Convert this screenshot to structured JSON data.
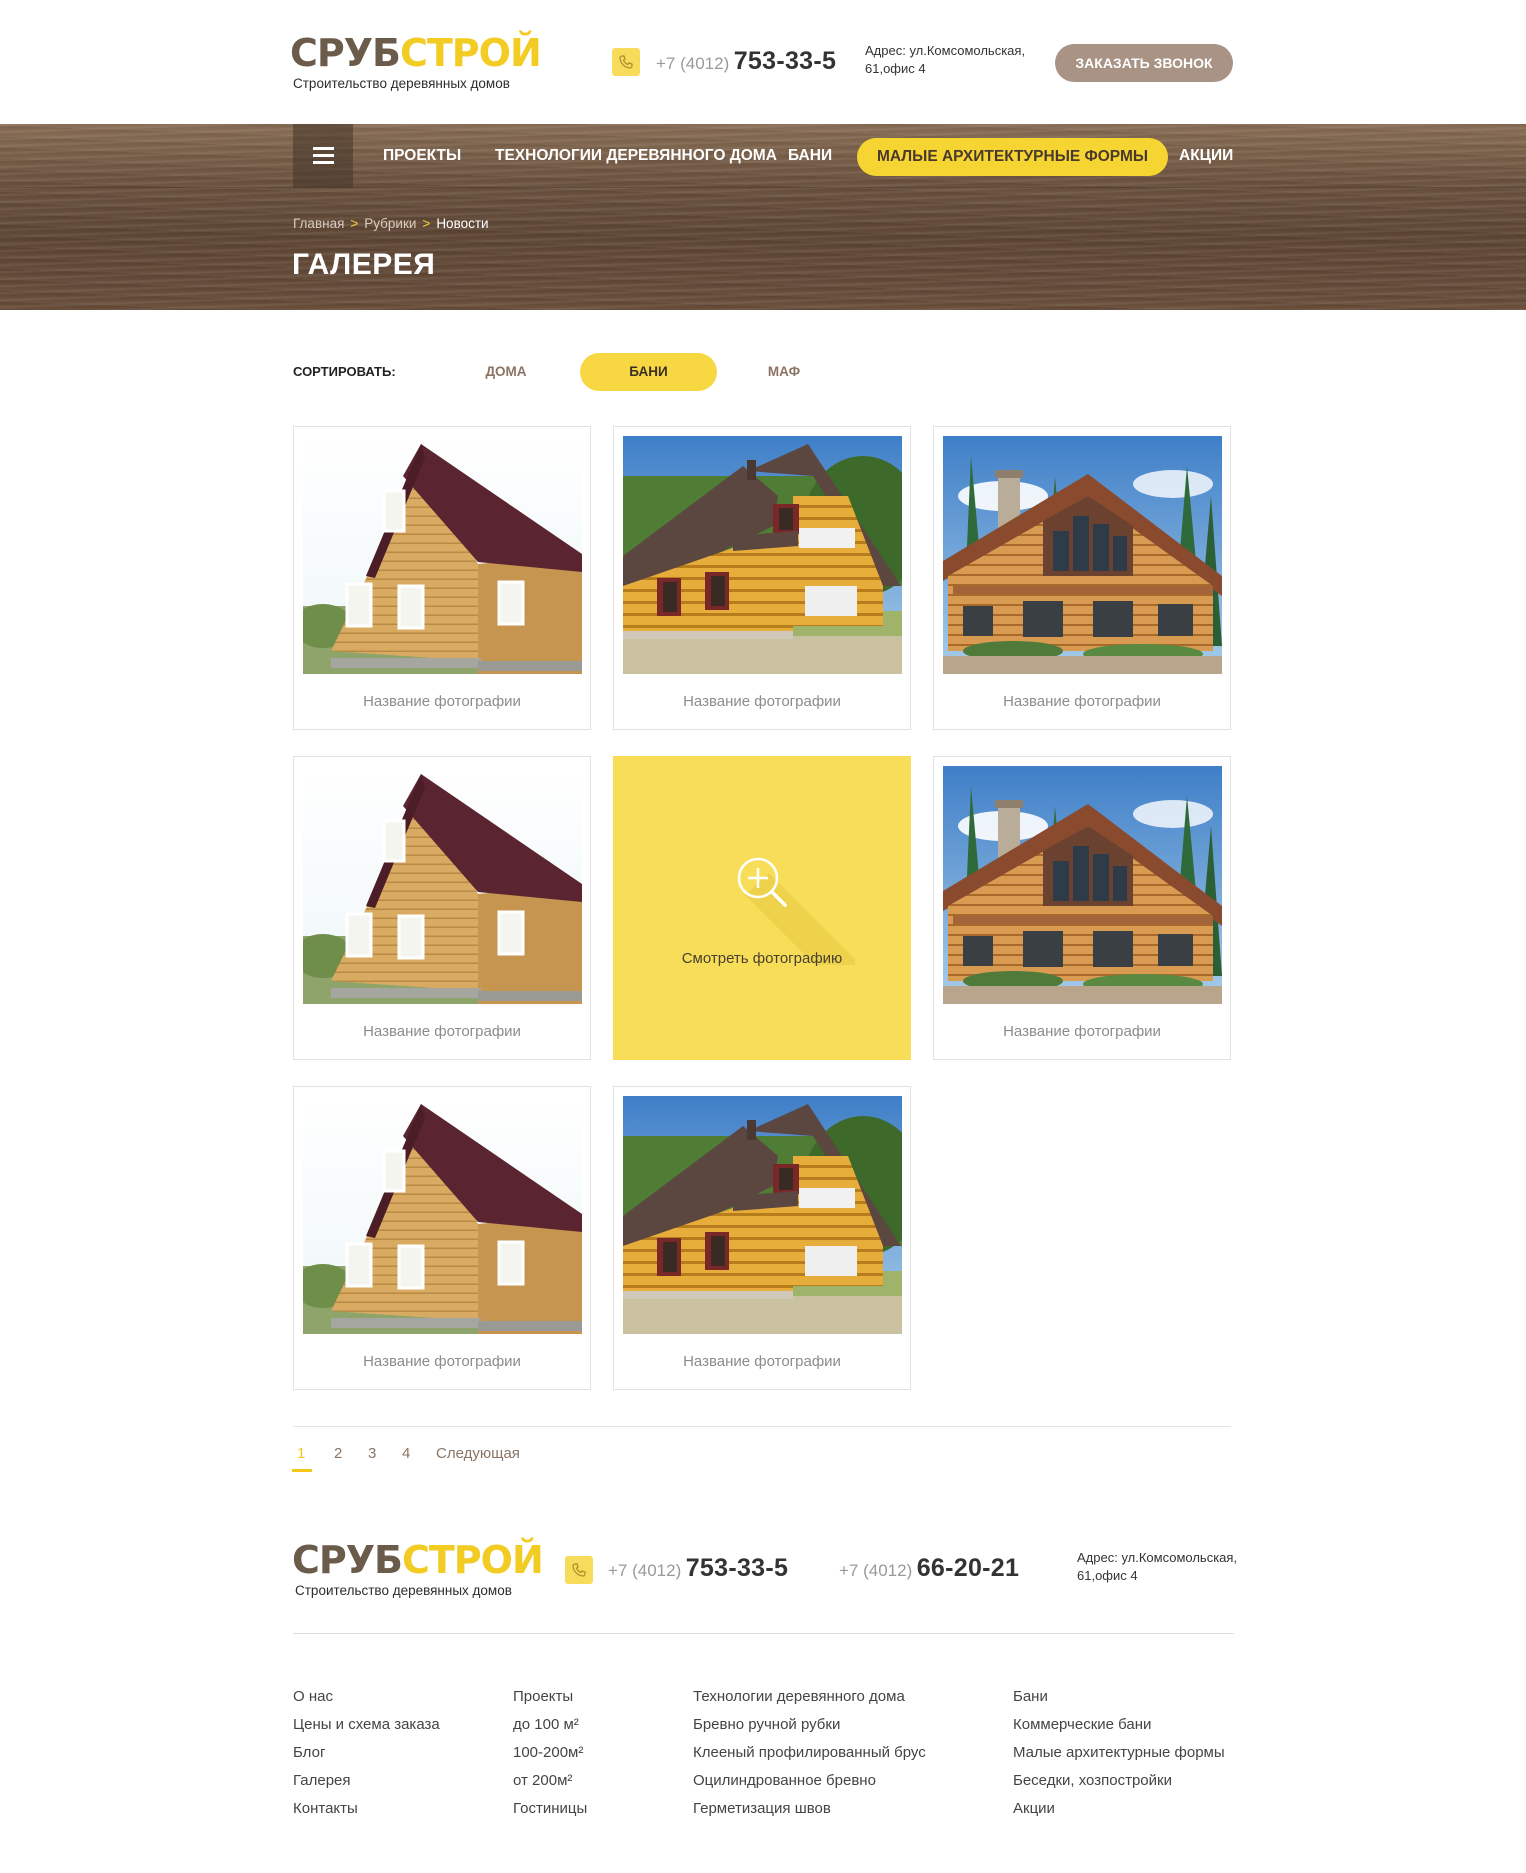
{
  "header": {
    "logo_part1": "СРУБ",
    "logo_part2": "СТРОЙ",
    "logo_tagline": "Строительство деревянных домов",
    "phone_code": "+7 (4012)",
    "phone_number": "753-33-5",
    "address": "Адрес: ул.Комсомольская, 61,офис 4",
    "callback_label": "ЗАКАЗАТЬ ЗВОНОК"
  },
  "nav": {
    "items": [
      "ПРОЕКТЫ",
      "ТЕХНОЛОГИИ ДЕРЕВЯННОГО ДОМА",
      "БАНИ",
      "МАЛЫЕ АРХИТЕКТУРНЫЕ ФОРМЫ",
      "АКЦИИ"
    ],
    "active_index": 3
  },
  "breadcrumb": [
    "Главная",
    "Рубрики",
    "Новости"
  ],
  "page_title": "ГАЛЕРЕЯ",
  "sort": {
    "label": "СОРТИРОВАТЬ:",
    "options": [
      "ДОМА",
      "БАНИ",
      "МАФ"
    ],
    "active_index": 1
  },
  "gallery": {
    "items": [
      {
        "caption": "Название фотографии",
        "image": "timber-house"
      },
      {
        "caption": "Название фотографии",
        "image": "log-house"
      },
      {
        "caption": "Название фотографии",
        "image": "chalet-house"
      },
      {
        "caption": "Название фотографии",
        "image": "timber-house"
      },
      {
        "caption": "Смотреть фотографию",
        "image": "zoom-overlay",
        "hover": true
      },
      {
        "caption": "Название фотографии",
        "image": "chalet-house"
      },
      {
        "caption": "Название фотографии",
        "image": "timber-house"
      },
      {
        "caption": "Название фотографии",
        "image": "log-house"
      }
    ]
  },
  "pagination": {
    "pages": [
      "1",
      "2",
      "3",
      "4"
    ],
    "next_label": "Следующая",
    "current": 1
  },
  "footer": {
    "logo_part1": "СРУБ",
    "logo_part2": "СТРОЙ",
    "logo_tagline": "Строительство деревянных домов",
    "phone1_code": "+7 (4012)",
    "phone1_number": "753-33-5",
    "phone2_code": "+7 (4012)",
    "phone2_number": "66-20-21",
    "address": "Адрес: ул.Комсомольская, 61,офис 4",
    "columns": [
      [
        "О нас",
        "Цены и схема заказа",
        "Блог",
        "Галерея",
        "Контакты"
      ],
      [
        "Проекты",
        "до 100 м²",
        "100-200м²",
        "от 200м²",
        "Гостиницы"
      ],
      [
        "Технологии деревянного дома",
        "Бревно ручной рубки",
        "Клееный профилированный брус",
        "Оцилиндрованное бревно",
        "Герметизация швов"
      ],
      [
        "Бани",
        "Коммерческие бани",
        "Малые архитектурные формы",
        "Беседки, хозпостройки",
        "Акции"
      ]
    ]
  },
  "colors": {
    "accent": "#f6d532",
    "brand_brown": "#6a5b4b",
    "callback_button": "#a89384",
    "link_brown": "#8b7464"
  }
}
